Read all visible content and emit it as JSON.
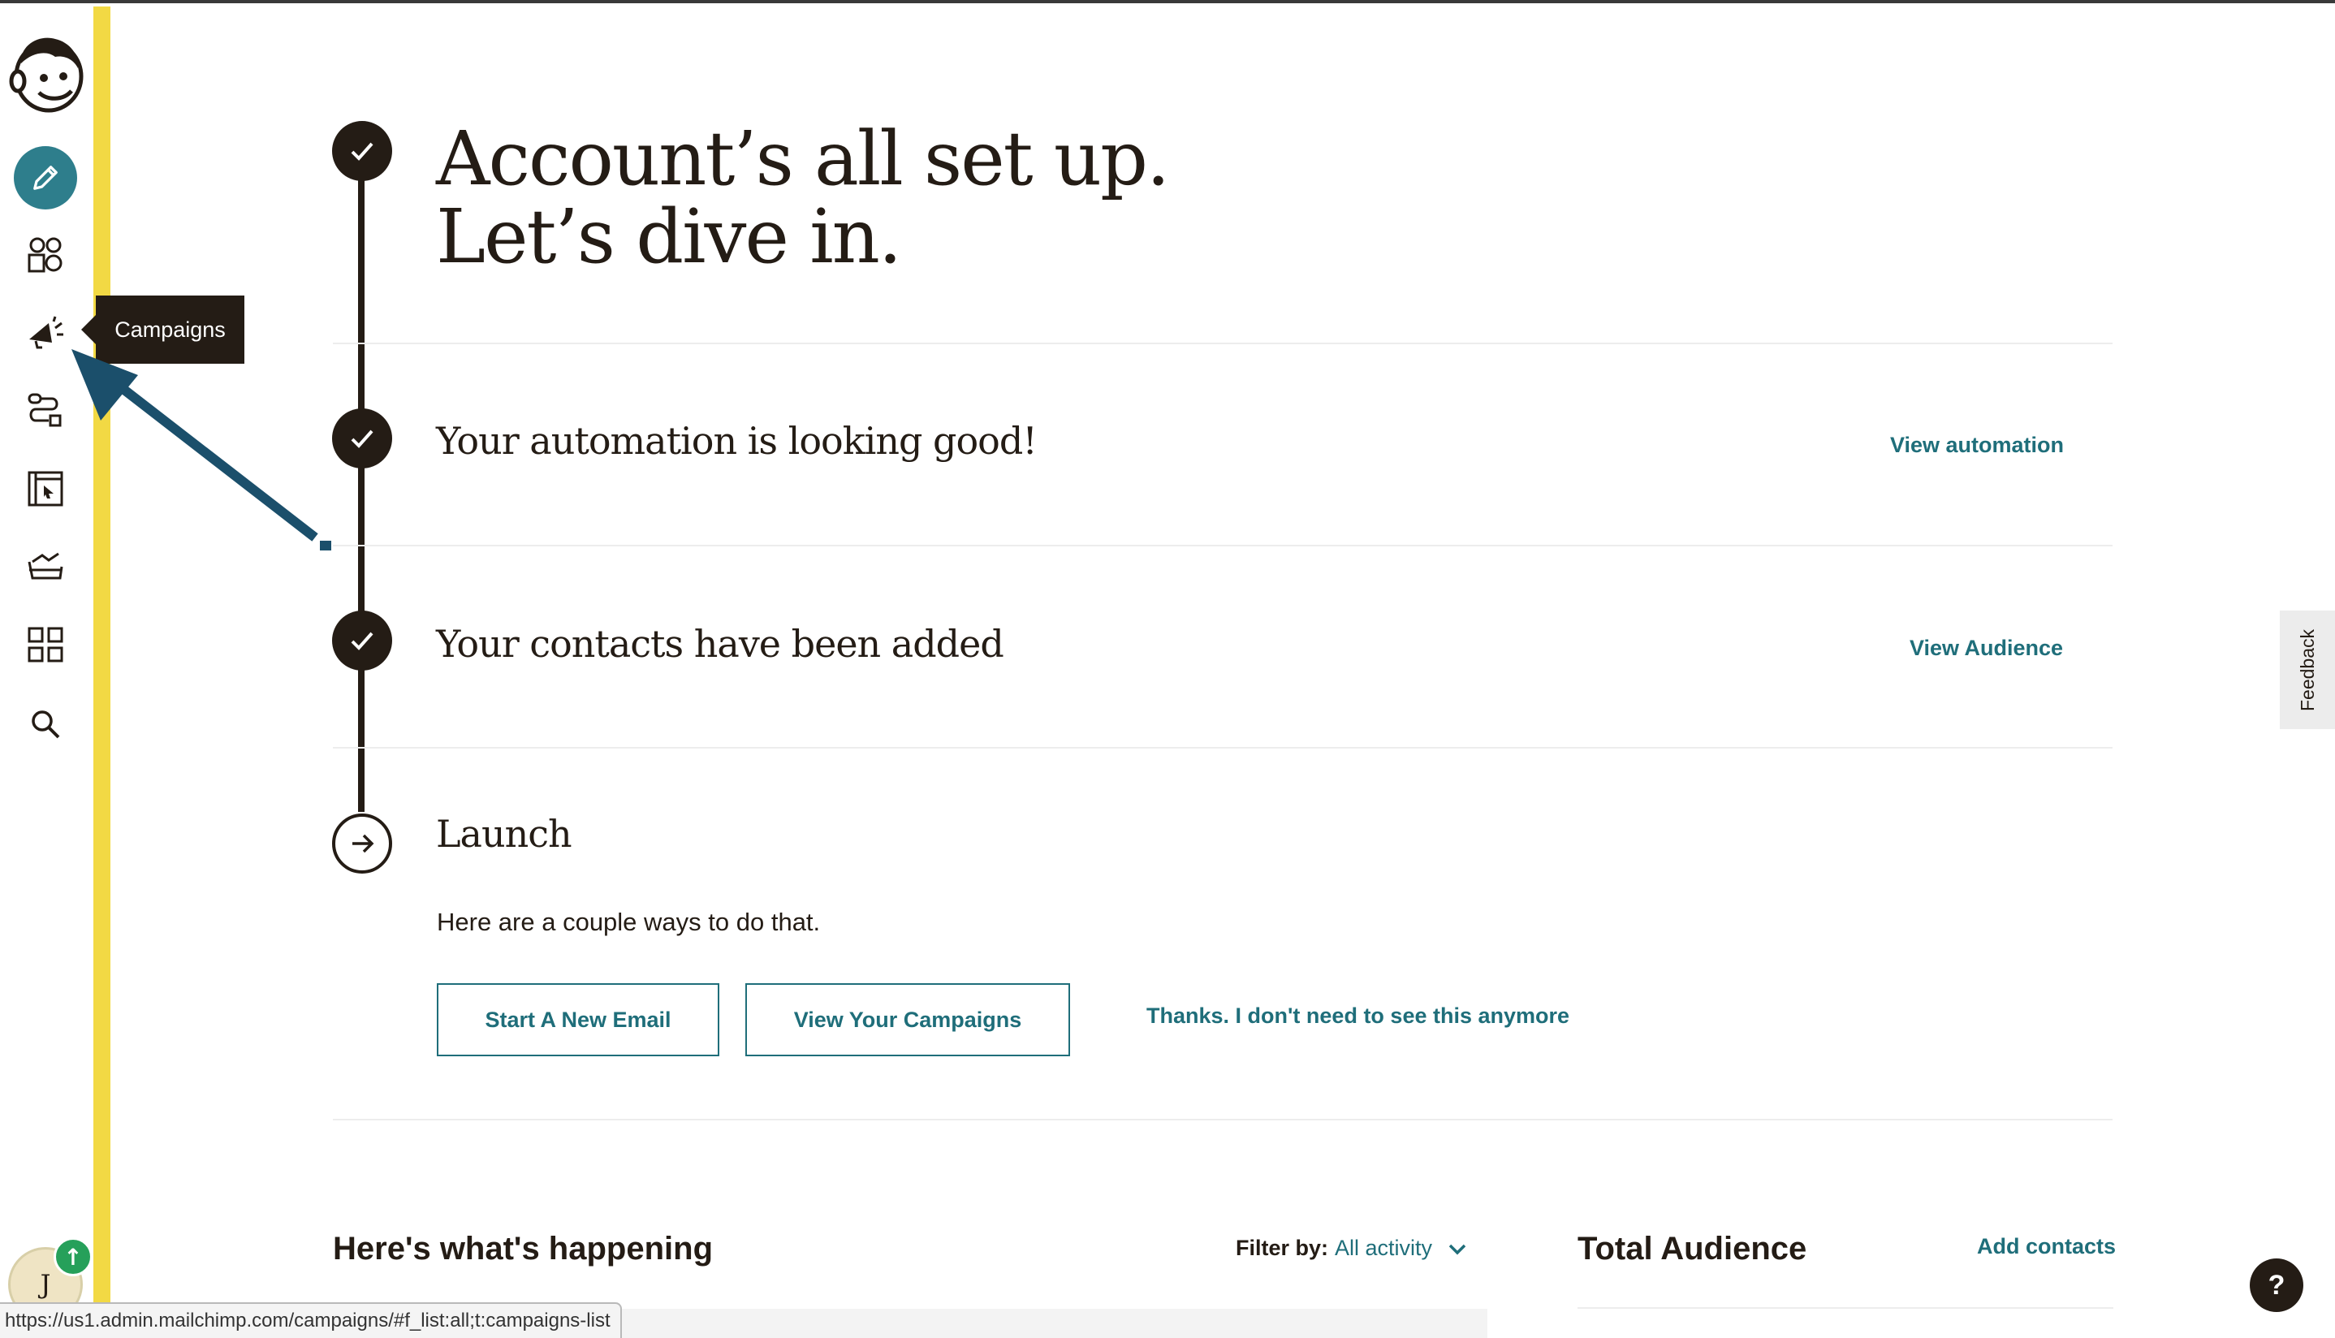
{
  "sidebar": {
    "tooltip": "Campaigns",
    "avatar_initial": "J",
    "avatar_badge": "↑",
    "icons": [
      "mailchimp-logo",
      "pencil-icon",
      "audience-icon",
      "megaphone-icon",
      "automation-icon",
      "website-icon",
      "content-icon",
      "integrations-icon",
      "search-icon"
    ]
  },
  "hero": {
    "line1": "Account’s all set up.",
    "line2": "Let’s dive in."
  },
  "steps": [
    {
      "title": "Your automation is looking good!",
      "link": "View automation",
      "done": true
    },
    {
      "title": "Your contacts have been added",
      "link": "View Audience",
      "done": true
    },
    {
      "title": "Launch",
      "done": false
    }
  ],
  "launch": {
    "subtitle": "Here are a couple ways to do that.",
    "primary_button": "Start A New Email",
    "secondary_button": "View Your Campaigns",
    "dismiss_link": "Thanks. I don't need to see this anymore"
  },
  "activity": {
    "title": "Here's what's happening",
    "filter_label": "Filter by:",
    "filter_value": "All activity"
  },
  "audience": {
    "title": "Total Audience",
    "add_link": "Add contacts"
  },
  "feedback_tab": "Feedback",
  "help_button": "?",
  "status_url": "https://us1.admin.mailchimp.com/campaigns/#f_list:all;t:campaigns-list",
  "colors": {
    "accent_teal": "#1f6e7a",
    "create_button": "#2e7e8c",
    "yellow_strip": "#f2d944",
    "ink": "#241c15",
    "annotation_arrow": "#1b4f6b",
    "badge_green": "#26a05a"
  }
}
